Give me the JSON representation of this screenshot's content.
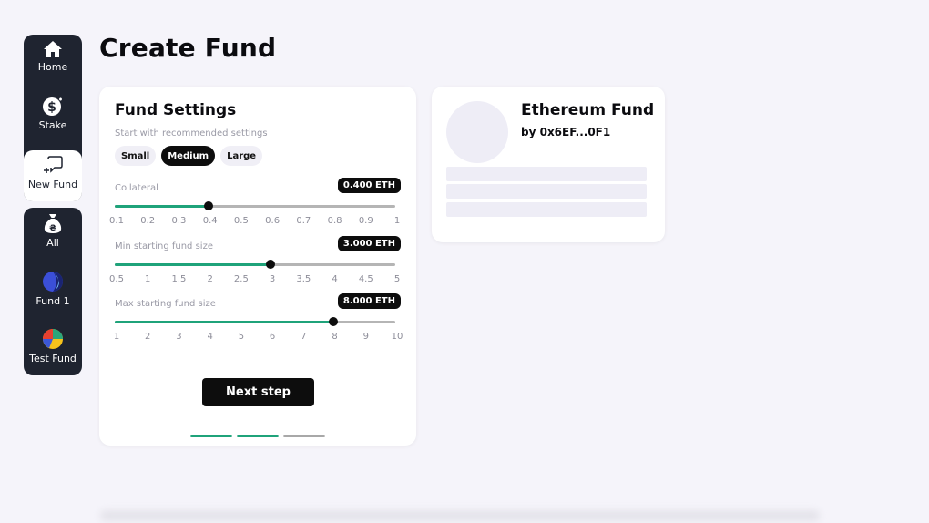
{
  "page": {
    "title": "Create Fund"
  },
  "sidebar": {
    "items": [
      {
        "label": "Home"
      },
      {
        "label": "Stake"
      },
      {
        "label": "New Fund"
      }
    ],
    "funds": [
      {
        "label": "All"
      },
      {
        "label": "Fund 1"
      },
      {
        "label": "Test Fund"
      }
    ]
  },
  "settings": {
    "title": "Fund Settings",
    "hint": "Start with recommended settings",
    "presets": [
      "Small",
      "Medium",
      "Large"
    ],
    "selected_preset": "Medium",
    "sliders": [
      {
        "label": "Collateral",
        "value_display": "0.400 ETH",
        "value": 0.4,
        "min": 0.1,
        "max": 1,
        "ticks": [
          "0.1",
          "0.2",
          "0.3",
          "0.4",
          "0.5",
          "0.6",
          "0.7",
          "0.8",
          "0.9",
          "1"
        ]
      },
      {
        "label": "Min starting fund size",
        "value_display": "3.000 ETH",
        "value": 3,
        "min": 0.5,
        "max": 5,
        "ticks": [
          "0.5",
          "1",
          "1.5",
          "2",
          "2.5",
          "3",
          "3.5",
          "4",
          "4.5",
          "5"
        ]
      },
      {
        "label": "Max starting fund size",
        "value_display": "8.000 ETH",
        "value": 8,
        "min": 1,
        "max": 10,
        "ticks": [
          "1",
          "2",
          "3",
          "4",
          "5",
          "6",
          "7",
          "8",
          "9",
          "10"
        ]
      }
    ],
    "next_label": "Next step",
    "steps_total": 3,
    "steps_done": 2
  },
  "preview": {
    "name": "Ethereum Fund",
    "owner": "by 0x6EF...0F1"
  },
  "colors": {
    "sidebar_bg": "#1f2430",
    "accent_green": "#1fa37a",
    "dark": "#0d0d0d",
    "page_bg": "#f5f4fa"
  },
  "icons": {
    "home": "home-icon",
    "stake": "dollar-coin-icon",
    "new_fund": "add-message-icon",
    "all": "money-bag-icon",
    "fund1": "fund-avatar-icon",
    "test_fund": "fund-avatar-icon"
  }
}
